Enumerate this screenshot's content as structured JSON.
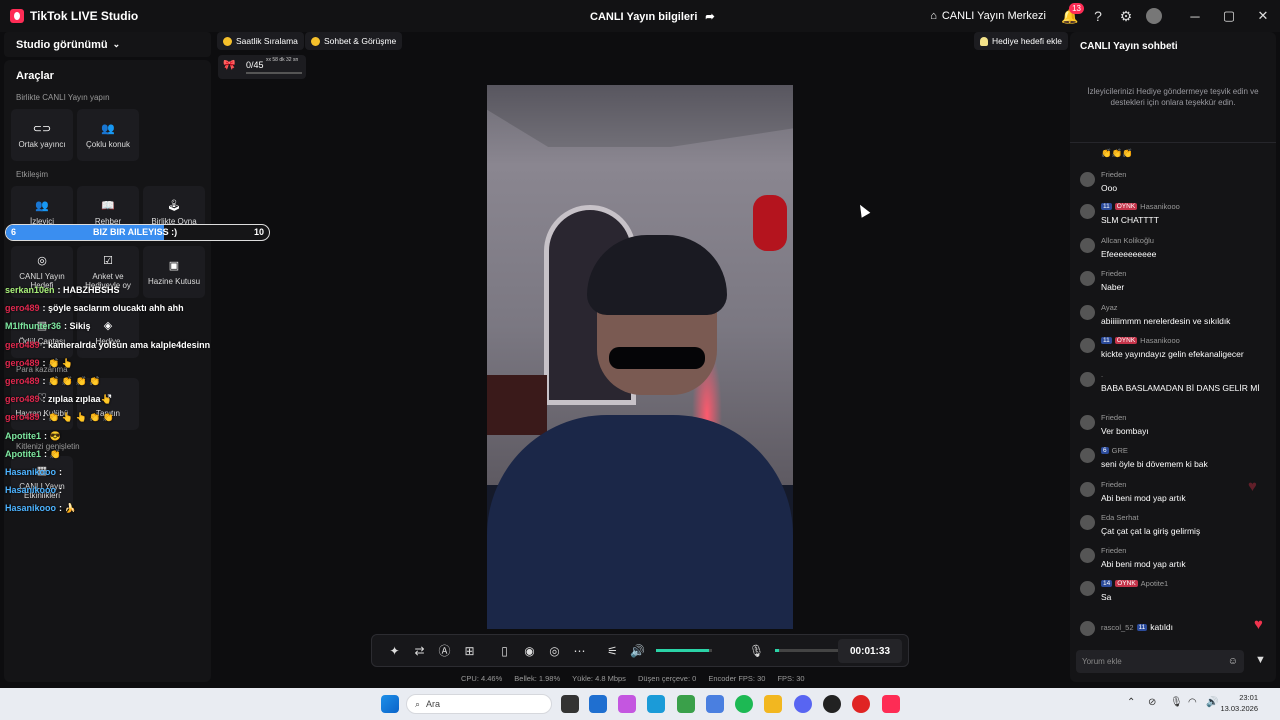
{
  "titlebar": {
    "app_name": "TikTok LIVE Studio",
    "center_title": "CANLI Yayın bilgileri",
    "live_center": "CANLI Yayın Merkezi",
    "notif_count": "13"
  },
  "left": {
    "studio_view": "Studio görünümü",
    "tools_title": "Araçlar",
    "section_together": "Birlikte CANLI Yayın yapın",
    "section_interaction": "Etkileşim",
    "tiles": {
      "cohost": "Ortak yayıncı",
      "multi_guest": "Çoklu konuk",
      "viewer": "İzleyici",
      "guide": "Rehber",
      "play_together": "Birlikte Oyna",
      "live_goal": "CANLI Yayın Hedefi",
      "poll": "Anket ve Hediyeyle oy",
      "treasure": "Hazine Kutusu",
      "reward_bag": "Ödül Çantası",
      "gift": "Hediye",
      "earn": "Para kazanma",
      "fan_club": "Hayran Kulübü",
      "promote": "Tanıtın",
      "kit": "Kitlenizi genişletin",
      "live_events": "CANLI Yayın Etkinlikleri"
    }
  },
  "goal": {
    "left_num": "6",
    "text": "BIZ BIR AILEYISS :)",
    "right_num": "10",
    "progress": 0.6
  },
  "overlay_chat": [
    {
      "user": "serkan10en",
      "text": ": HABZHBSHS"
    },
    {
      "user": "gero489",
      "text": ": şöyle saclarım olucaktı ahh ahh"
    },
    {
      "user": "M1lfhunter36",
      "text": ": Sikiş"
    },
    {
      "user": "gero489",
      "text": ": kameralrda yolsun ama kalple4desinn"
    },
    {
      "user": "gero489",
      "text": ": 👏 👆"
    },
    {
      "user": "gero489",
      "text": ": 👏 👏 👏 👏"
    },
    {
      "user": "gero489",
      "text": ": zıplaa zıplaa👆"
    },
    {
      "user": "gero489",
      "text": ": 👏 👆 👆 👏 👏"
    },
    {
      "user": "Apotite1",
      "text": ": 😎"
    },
    {
      "user": "Apotite1",
      "text": ": 👏"
    },
    {
      "user": "Hasanikooo",
      "text": ":"
    },
    {
      "user": "Hasanikooo",
      "text": ":"
    },
    {
      "user": "Hasanikooo",
      "text": ": 🍌"
    }
  ],
  "chips": {
    "hourly": "Saatlik Sıralama",
    "chat_meet": "Sohbet & Görüşme",
    "gift_goal": "Hediye hedefi ekle"
  },
  "counter": {
    "value": "0/45",
    "time": "xx 58 dk 32 sn"
  },
  "controls": {
    "timer": "00:01:33",
    "volume": 0.95,
    "mic": 0.05
  },
  "stats": {
    "cpu": "CPU: 4.46%",
    "memory": "Bellek: 1.98%",
    "upload": "Yükle: 4.8 Mbps",
    "dropped": "Düşen çerçeve: 0",
    "encoder": "Encoder FPS: 30",
    "fps": "FPS: 30"
  },
  "chat": {
    "title": "CANLI Yayın sohbeti",
    "tip": "İzleyicilerinizi Hediye göndermeye teşvik edin ve destekleri için onlara teşekkür edin.",
    "placeholder": "Yorum ekle",
    "messages": [
      {
        "name": "",
        "text": "👏👏👏"
      },
      {
        "name": "Frieden",
        "text": "Ooo"
      },
      {
        "name": "Hasanikooo",
        "level": "11",
        "badge": "OYNK",
        "text": "SLM CHATTTT"
      },
      {
        "name": "Allcan Kolikoğlu",
        "text": "Efeeeeeeeeee"
      },
      {
        "name": "Frieden",
        "text": "Naber"
      },
      {
        "name": "Ayaz",
        "text": "abiiiiimmm nerelerdesin ve sıkıldık"
      },
      {
        "name": "Hasanikooo",
        "level": "11",
        "badge": "OYNK",
        "text": "kickte yayındayız gelin efekanaligecer"
      },
      {
        "name": ".",
        "text": "BABA BASLAMADAN Bİ DANS GELİR Mİ"
      },
      {
        "name": "Frieden",
        "text": "Ver bombayı"
      },
      {
        "name": "GRE",
        "level": "6",
        "text": "seni öyle bi dövemem ki bak"
      },
      {
        "name": "Frieden",
        "text": "Abi beni mod yap artık"
      },
      {
        "name": "Eda Serhat",
        "text": "Çat çat çat la giriş gelirmiş"
      },
      {
        "name": "Frieden",
        "text": "Abi beni mod yap artık"
      },
      {
        "name": "Apotite1",
        "level": "14",
        "badge": "OYNK",
        "text": "Sa"
      }
    ],
    "join": {
      "name": "rascol_52",
      "level": "11",
      "text": "katıldı"
    }
  },
  "taskbar": {
    "search": "Ara",
    "time": "23:01",
    "date": "13.03.2026"
  }
}
